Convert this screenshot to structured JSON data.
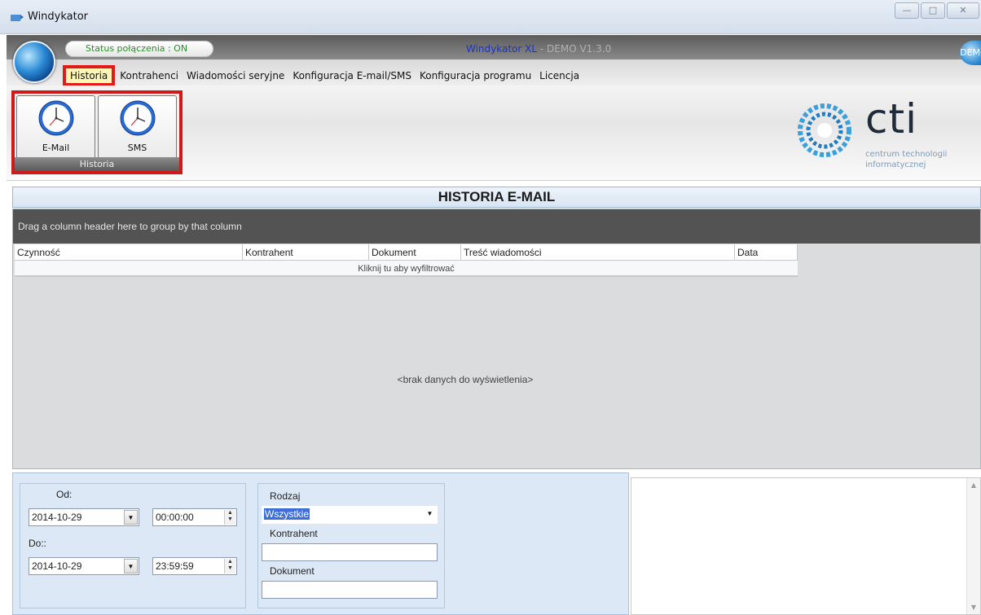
{
  "window": {
    "title": "Windykator"
  },
  "header": {
    "status": "Status połączenia : ON",
    "product_name": "Windykator XL",
    "product_version": "- DEMO V1.3.0",
    "badge": "DEMO"
  },
  "menu": [
    "Historia",
    "Kontrahenci",
    "Wiadomości seryjne",
    "Konfiguracja E-mail/SMS",
    "Konfiguracja programu",
    "Licencja"
  ],
  "toolbar": {
    "group_label": "Historia",
    "buttons": [
      {
        "label": "E-Mail",
        "icon": "clock-icon"
      },
      {
        "label": "SMS",
        "icon": "clock-icon"
      }
    ]
  },
  "logo": {
    "word": "cti",
    "line1": "centrum technologii",
    "line2": "informatycznej"
  },
  "main": {
    "title": "HISTORIA E-MAIL",
    "group_hint": "Drag a column header here to group by that column",
    "columns": [
      "Czynność",
      "Kontrahent",
      "Dokument",
      "Treść wiadomości",
      "Data"
    ],
    "filter_hint": "Kliknij tu aby wyfiltrować",
    "empty": "<brak danych  do wyświetlenia>"
  },
  "filters": {
    "od_label": "Od:",
    "od_date": "2014-10-29",
    "od_time": "00:00:00",
    "do_label": "Do::",
    "do_date": "2014-10-29",
    "do_time": "23:59:59",
    "rodzaj_label": "Rodzaj",
    "rodzaj_value": "Wszystkie",
    "kontrahent_label": "Kontrahent",
    "kontrahent_value": "",
    "dokument_label": "Dokument",
    "dokument_value": ""
  }
}
